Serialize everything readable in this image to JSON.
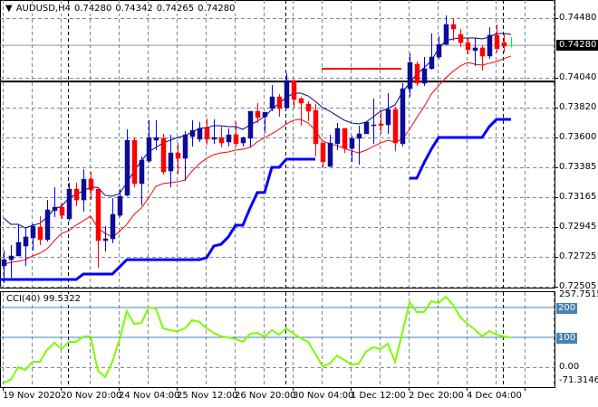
{
  "header": {
    "symbol": "AUDUSD,H4",
    "open": "0.74280",
    "high": "0.74342",
    "low": "0.74265",
    "close": "0.74280",
    "menu_icon": "triangle-down-icon"
  },
  "price_axis": {
    "labels": [
      "0.74480",
      "0.74040",
      "0.73820",
      "0.73600",
      "0.73385",
      "0.73165",
      "0.72945",
      "0.72725",
      "0.72505"
    ],
    "current_price": "0.74280",
    "range": [
      0.72505,
      0.7448
    ]
  },
  "indicator": {
    "label": "CCI(40) 99.5322",
    "max_label": "257.7515",
    "min_label": "-71.3146",
    "zero_label": "0.00",
    "level_200": "200",
    "level_100": "100",
    "range": [
      -71.3146,
      257.7515
    ]
  },
  "time_axis": [
    "19 Nov 2020",
    "20 Nov 20:00",
    "24 Nov 04:00",
    "25 Nov 12:00",
    "26 Nov 20:00",
    "30 Nov 04:00",
    "1 Dec 12:00",
    "2 Dec 20:00",
    "4 Dec 04:00"
  ],
  "colors": {
    "bull_body": "#0c0c96",
    "bull_wick": "#0000ff",
    "bear": "#ff0000",
    "ma_fast": "#00008b",
    "ma_slow": "#ff0000",
    "step_line": "#0000ff",
    "cci": "#7cfc00",
    "level": "#4682b4",
    "grid": "#7a8899"
  },
  "chart_data": {
    "type": "candlestick",
    "title": "AUDUSD,H4",
    "candles": [
      [
        0.72658,
        0.72771,
        0.72532,
        0.72704
      ],
      [
        0.72704,
        0.72811,
        0.72571,
        0.72731
      ],
      [
        0.72731,
        0.72964,
        0.72731,
        0.72831
      ],
      [
        0.72804,
        0.72937,
        0.72658,
        0.72871
      ],
      [
        0.72864,
        0.72964,
        0.72771,
        0.7295
      ],
      [
        0.72944,
        0.73024,
        0.72811,
        0.72851
      ],
      [
        0.72851,
        0.73143,
        0.72837,
        0.7307
      ],
      [
        0.73064,
        0.73236,
        0.73017,
        0.7309
      ],
      [
        0.7309,
        0.73117,
        0.73004,
        0.7303
      ],
      [
        0.73004,
        0.7327,
        0.7299,
        0.73223
      ],
      [
        0.73223,
        0.7327,
        0.73097,
        0.73143
      ],
      [
        0.73143,
        0.73369,
        0.73057,
        0.73296
      ],
      [
        0.73296,
        0.73349,
        0.73143,
        0.73216
      ],
      [
        0.73223,
        0.73223,
        0.72645,
        0.72844
      ],
      [
        0.72844,
        0.7295,
        0.72764,
        0.72857
      ],
      [
        0.72857,
        0.73157,
        0.72824,
        0.73037
      ],
      [
        0.7303,
        0.73223,
        0.73017,
        0.7317
      ],
      [
        0.73177,
        0.73662,
        0.7317,
        0.73582
      ],
      [
        0.73582,
        0.73602,
        0.73236,
        0.73263
      ],
      [
        0.73263,
        0.73463,
        0.73103,
        0.73436
      ],
      [
        0.73429,
        0.73729,
        0.73416,
        0.73602
      ],
      [
        0.73582,
        0.73729,
        0.73509,
        0.73602
      ],
      [
        0.73596,
        0.73629,
        0.7333,
        0.73349
      ],
      [
        0.73356,
        0.73622,
        0.73236,
        0.73489
      ],
      [
        0.73489,
        0.73562,
        0.73336,
        0.73449
      ],
      [
        0.73449,
        0.73649,
        0.73283,
        0.73622
      ],
      [
        0.73609,
        0.73729,
        0.73536,
        0.73655
      ],
      [
        0.73589,
        0.73715,
        0.73569,
        0.73669
      ],
      [
        0.73675,
        0.73742,
        0.73549,
        0.73589
      ],
      [
        0.73589,
        0.73735,
        0.73556,
        0.73602
      ],
      [
        0.73602,
        0.73682,
        0.73529,
        0.73562
      ],
      [
        0.73569,
        0.73669,
        0.73536,
        0.73622
      ],
      [
        0.73622,
        0.73715,
        0.73536,
        0.73556
      ],
      [
        0.73562,
        0.73609,
        0.73536,
        0.73602
      ],
      [
        0.73596,
        0.73795,
        0.73529,
        0.73795
      ],
      [
        0.73795,
        0.73855,
        0.73709,
        0.73748
      ],
      [
        0.73755,
        0.73788,
        0.73635,
        0.73788
      ],
      [
        0.73815,
        0.73988,
        0.73795,
        0.73901
      ],
      [
        0.73901,
        0.73921,
        0.73755,
        0.73815
      ],
      [
        0.73822,
        0.74074,
        0.73815,
        0.74021
      ],
      [
        0.74021,
        0.74028,
        0.73822,
        0.73881
      ],
      [
        0.73888,
        0.73901,
        0.73689,
        0.73855
      ],
      [
        0.73848,
        0.73868,
        0.73722,
        0.73795
      ],
      [
        0.73802,
        0.73848,
        0.73463,
        0.73556
      ],
      [
        0.73562,
        0.73562,
        0.73383,
        0.73423
      ],
      [
        0.73389,
        0.73622,
        0.73389,
        0.73562
      ],
      [
        0.73556,
        0.73709,
        0.73509,
        0.73669
      ],
      [
        0.73669,
        0.73669,
        0.73489,
        0.73522
      ],
      [
        0.73522,
        0.73615,
        0.73423,
        0.73596
      ],
      [
        0.73596,
        0.73689,
        0.73403,
        0.73629
      ],
      [
        0.73629,
        0.73722,
        0.73629,
        0.73715
      ],
      [
        0.73689,
        0.73888,
        0.73556,
        0.73695
      ],
      [
        0.73702,
        0.73795,
        0.73629,
        0.73689
      ],
      [
        0.73695,
        0.73928,
        0.73629,
        0.73808
      ],
      [
        0.73808,
        0.73828,
        0.73502,
        0.73562
      ],
      [
        0.73556,
        0.74001,
        0.73536,
        0.73961
      ],
      [
        0.73961,
        0.74221,
        0.73901,
        0.74154
      ],
      [
        0.74141,
        0.74161,
        0.73981,
        0.74001
      ],
      [
        0.74001,
        0.74194,
        0.73981,
        0.74108
      ],
      [
        0.74108,
        0.74367,
        0.74101,
        0.74194
      ],
      [
        0.74194,
        0.74347,
        0.74181,
        0.74287
      ],
      [
        0.74287,
        0.745,
        0.7428,
        0.74433
      ],
      [
        0.74433,
        0.7448,
        0.74314,
        0.744
      ],
      [
        0.7436,
        0.744,
        0.74267,
        0.743
      ],
      [
        0.743,
        0.74334,
        0.74214,
        0.74247
      ],
      [
        0.74241,
        0.74334,
        0.74128,
        0.74261
      ],
      [
        0.74261,
        0.7428,
        0.74094,
        0.74201
      ],
      [
        0.74201,
        0.74413,
        0.74181,
        0.74354
      ],
      [
        0.74354,
        0.74433,
        0.74227,
        0.74254
      ],
      [
        0.743,
        0.74367,
        0.74227,
        0.74274
      ],
      [
        0.7428,
        0.74342,
        0.74265,
        0.7428
      ]
    ],
    "ma_fast": [
      0.7301,
      0.72964,
      0.72964,
      0.72937,
      0.72957,
      0.7297,
      0.73017,
      0.73077,
      0.73097,
      0.73157,
      0.73183,
      0.7321,
      0.73236,
      0.73236,
      0.73177,
      0.7317,
      0.7319,
      0.7327,
      0.73356,
      0.73429,
      0.73496,
      0.73529,
      0.73562,
      0.73582,
      0.73602,
      0.73615,
      0.73642,
      0.73669,
      0.73675,
      0.73689,
      0.73689,
      0.73682,
      0.73682,
      0.73662,
      0.73695,
      0.73722,
      0.73755,
      0.73808,
      0.73855,
      0.73895,
      0.73928,
      0.73928,
      0.73908,
      0.73868,
      0.73822,
      0.73795,
      0.73762,
      0.73729,
      0.73709,
      0.73702,
      0.73715,
      0.73755,
      0.73795,
      0.73815,
      0.73842,
      0.73935,
      0.74001,
      0.74068,
      0.74114,
      0.74167,
      0.74254,
      0.74314,
      0.74327,
      0.74334,
      0.74334,
      0.74334,
      0.74327,
      0.7434,
      0.74367,
      0.74367,
      0.7436
    ],
    "ma_slow": [
      0.72671,
      0.72684,
      0.72691,
      0.72704,
      0.72731,
      0.72751,
      0.72784,
      0.72844,
      0.72897,
      0.72917,
      0.72957,
      0.7299,
      0.73024,
      0.72937,
      0.72897,
      0.72871,
      0.72911,
      0.72964,
      0.73037,
      0.73083,
      0.73157,
      0.73243,
      0.73263,
      0.7327,
      0.73276,
      0.7329,
      0.73356,
      0.73409,
      0.73449,
      0.73476,
      0.73489,
      0.73496,
      0.73509,
      0.73516,
      0.73529,
      0.73569,
      0.73602,
      0.73629,
      0.73662,
      0.73702,
      0.73729,
      0.73735,
      0.73709,
      0.73655,
      0.73576,
      0.73556,
      0.73542,
      0.73522,
      0.73502,
      0.73489,
      0.73509,
      0.73536,
      0.73562,
      0.73582,
      0.73569,
      0.73589,
      0.73662,
      0.73748,
      0.73828,
      0.73921,
      0.73981,
      0.74041,
      0.74088,
      0.74128,
      0.74154,
      0.74141,
      0.74134,
      0.74147,
      0.74161,
      0.74181,
      0.74201
    ],
    "step_line": [
      0.72558,
      0.72558,
      0.72558,
      0.72558,
      0.72558,
      0.72558,
      0.72558,
      0.72558,
      0.72558,
      0.72558,
      0.72558,
      0.72598,
      0.72598,
      0.72598,
      0.72598,
      0.72598,
      0.72651,
      0.72704,
      0.72704,
      0.72704,
      0.72704,
      0.72704,
      0.72704,
      0.72704,
      0.72704,
      0.72704,
      0.72704,
      0.72704,
      0.72718,
      0.72804,
      0.72817,
      0.72871,
      0.72957,
      0.72957,
      0.73083,
      0.73197,
      0.73197,
      0.73383,
      0.73383,
      0.73443,
      0.73443,
      0.73443,
      0.73443,
      0.73443,
      null,
      null,
      null,
      null,
      null,
      null,
      null,
      null,
      null,
      null,
      null,
      null,
      0.73303,
      0.73303,
      0.73416,
      0.73516,
      0.73602,
      0.73602,
      0.73602,
      0.73602,
      0.73602,
      0.73602,
      0.73602,
      0.73682,
      0.73735,
      0.73735,
      0.73735
    ],
    "cci": [
      -52,
      -42,
      0,
      -9,
      18,
      18,
      58,
      82,
      61,
      85,
      85,
      103,
      103,
      -12,
      -33,
      18,
      94,
      188,
      145,
      148,
      200,
      197,
      130,
      124,
      121,
      130,
      158,
      152,
      130,
      115,
      103,
      100,
      94,
      85,
      112,
      115,
      103,
      124,
      109,
      130,
      112,
      97,
      85,
      45,
      3,
      12,
      39,
      24,
      9,
      12,
      52,
      67,
      61,
      79,
      18,
      115,
      218,
      185,
      185,
      221,
      215,
      236,
      209,
      167,
      145,
      127,
      103,
      121,
      109,
      103,
      99.5322
    ],
    "hlines": {
      "support_resistance": 0.74014,
      "red_segment": {
        "price": 0.74108,
        "from_bar": 44,
        "to_bar": 55
      }
    },
    "cci_levels": [
      200,
      100,
      0
    ]
  }
}
